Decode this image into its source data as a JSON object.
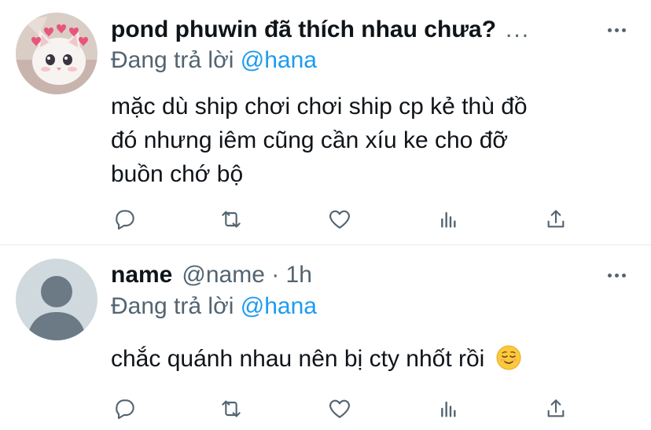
{
  "tweets": [
    {
      "name": "pond phuwin đã thích nhau chưa?",
      "name_ellipsis": "...",
      "replying_prefix": "Đang trả lời",
      "replying_to": "@hana",
      "text_lines": [
        "mặc dù ship chơi chơi ship cp kẻ thù đồ",
        "đó nhưng iêm cũng cần xíu ke cho đỡ",
        "buồn chớ bộ"
      ],
      "avatar_icon": "white-cat-hearts-avatar"
    },
    {
      "name": "name",
      "handle_time": "@name · 1h",
      "replying_prefix": "Đang trả lời",
      "replying_to": "@hana",
      "text": "chắc quánh nhau nên bị cty nhốt rồi",
      "emoji": "relieved-face-emoji",
      "avatar_icon": "default-avatar"
    }
  ],
  "actions": [
    "reply-icon",
    "retweet-icon",
    "like-icon",
    "analytics-icon",
    "share-icon"
  ],
  "colors": {
    "link": "#1d9bf0",
    "muted": "#536471",
    "text": "#0f1419",
    "divider": "#e6ecf0"
  }
}
